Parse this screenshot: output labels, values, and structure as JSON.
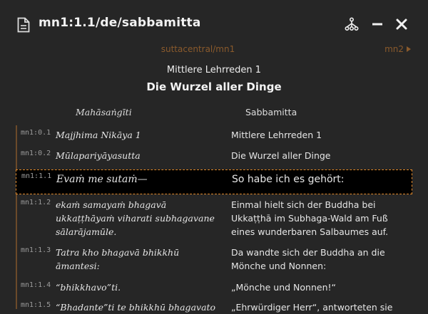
{
  "window": {
    "title": "mn1:1.1/de/sabbamitta"
  },
  "nav": {
    "source": "suttacentral/mn1",
    "next": "mn2"
  },
  "heading": {
    "collection": "Mittlere Lehrreden 1",
    "sutta": "Die Wurzel aller Dinge"
  },
  "columns": {
    "pali": "Mahāsaṅgīti",
    "translation": "Sabbamitta"
  },
  "segments": [
    {
      "id": "mn1:0.1",
      "pali": "Majjhima Nikāya 1",
      "trans": "Mittlere Lehrreden 1"
    },
    {
      "id": "mn1:0.2",
      "pali": "Mūlapariyāyasutta",
      "trans": "Die Wurzel aller Dinge"
    },
    {
      "id": "mn1:1.1",
      "pali": "Evaṁ me sutaṁ—",
      "trans": "So habe ich es gehört:"
    },
    {
      "id": "mn1:1.2",
      "pali": "ekaṁ samayaṁ bhagavā ukkaṭṭhāyaṁ viharati subhagavane sālarājamūle.",
      "trans": "Einmal hielt sich der Buddha bei Ukkaṭṭhā im Subhaga-Wald am Fuß eines wunderbaren Salbaumes auf."
    },
    {
      "id": "mn1:1.3",
      "pali": "Tatra kho bhagavā bhikkhū āmantesi:",
      "trans": "Da wandte sich der Buddha an die Mönche und Nonnen:"
    },
    {
      "id": "mn1:1.4",
      "pali": "“bhikkhavo”ti.",
      "trans": "„Mönche und Nonnen!“"
    },
    {
      "id": "mn1:1.5",
      "pali": "“Bhadante”ti te bhikkhū bhagavato",
      "trans": "„Ehrwürdiger Herr“, antworteten sie"
    }
  ],
  "colors": {
    "accent": "#e38b2c",
    "link": "#8a5a2c",
    "background": "#262626"
  }
}
